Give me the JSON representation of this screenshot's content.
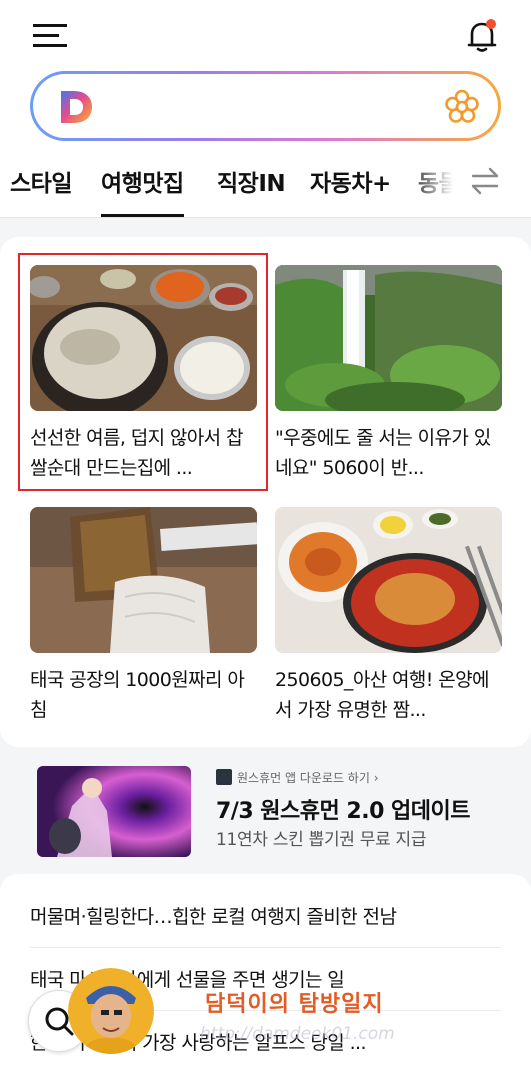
{
  "header": {
    "search_placeholder": ""
  },
  "tabs": [
    {
      "label": "스타일"
    },
    {
      "label": "여행맛집",
      "active": true
    },
    {
      "label": "직장IN"
    },
    {
      "label": "자동차+"
    },
    {
      "label": "동물"
    }
  ],
  "cards": [
    {
      "title": "선선한 여름, 덥지 않아서 찹쌀순대 만드는집에 ..."
    },
    {
      "title": "\"우중에도 줄 서는 이유가 있네요\" 5060이 반..."
    },
    {
      "title": "태국 공장의 1000원짜리 아침"
    },
    {
      "title": "250605_아산 여행! 온양에서 가장 유명한 짬..."
    }
  ],
  "ad": {
    "source": "원스휴먼 앱 다운로드 하기 ›",
    "title": "7/3 원스휴먼 2.0 업데이트",
    "subtitle": "11연차 스킨 뽑기권 무료 지급"
  },
  "list": [
    {
      "title": "머물며·힐링한다…힙한 로컬 여행지 즐비한 전남"
    },
    {
      "title": "태국 마사지사에게 선물을 주면 생기는 일"
    },
    {
      "title": "한국 아이들이 가장 사랑하는 알프스 당일 ..."
    }
  ],
  "watermark": {
    "text": "담덕이의 탐방일지",
    "url": "http://damdeok01.com"
  },
  "colors": {
    "accent_highlight": "#e3262b",
    "notification_dot": "#f0522d",
    "watermark": "#e35c26"
  }
}
